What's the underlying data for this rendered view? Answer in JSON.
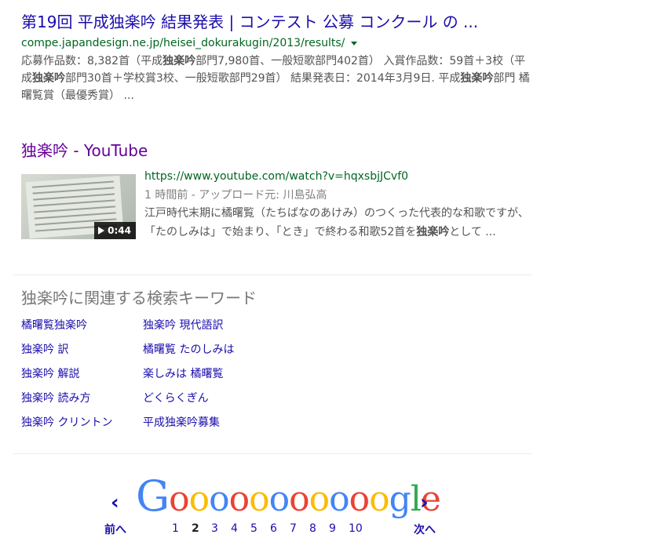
{
  "result1": {
    "title": "第19回 平成独楽吟 結果発表 | コンテスト 公募 コンクール の ...",
    "url": "compe.japandesign.ne.jp/heisei_dokurakugin/2013/results/",
    "snippet": [
      {
        "text": "応募作品数：8,382首（平成",
        "bold": false
      },
      {
        "text": "独楽吟",
        "bold": true
      },
      {
        "text": "部門7,980首、一般短歌部門402首） 入賞作品数：59首＋3校（平成",
        "bold": false
      },
      {
        "text": "独楽吟",
        "bold": true
      },
      {
        "text": "部門30首＋学校賞3校、一般短歌部門29首） 結果発表日：2014年3月9日. 平成",
        "bold": false
      },
      {
        "text": "独楽吟",
        "bold": true
      },
      {
        "text": "部門 橘曙覧賞（最優秀賞） ...",
        "bold": false
      }
    ]
  },
  "result2": {
    "title": "独楽吟 - YouTube",
    "url": "https://www.youtube.com/watch?v=hqxsbjJCvf0",
    "meta": "1 時間前 - アップロード元: 川島弘高",
    "duration": "0:44",
    "snippet": [
      {
        "text": "江戸時代末期に橘曙覧（たちばなのあけみ）のつくった代表的な和歌ですが、「たのしみは」で始まり、「とき」で終わる和歌52首を",
        "bold": false
      },
      {
        "text": "独楽吟",
        "bold": true
      },
      {
        "text": "として ...",
        "bold": false
      }
    ]
  },
  "related": {
    "title": "独楽吟に関連する検索キーワード",
    "items": [
      "橘曙覧独楽吟",
      "独楽吟 現代語訳",
      "独楽吟 訳",
      "橘曙覧 たのしみは",
      "独楽吟 解説",
      "楽しみは 橘曙覧",
      "独楽吟 読み方",
      "どくらくぎん",
      "独楽吟 クリントン",
      "平成独楽吟募集"
    ]
  },
  "pagination": {
    "prev_label": "前へ",
    "next_label": "次へ",
    "logo_text": "Gooooooooooogle",
    "current_page": 2,
    "pages": [
      "1",
      "2",
      "3",
      "4",
      "5",
      "6",
      "7",
      "8",
      "9",
      "10"
    ]
  },
  "icons": {
    "prev": "chevron-left-icon",
    "next": "chevron-right-icon",
    "play": "play-icon",
    "url_menu": "caret-down-icon"
  },
  "colors": {
    "link": "#1a0dab",
    "visited": "#660099",
    "url": "#006621",
    "snippet": "#545454"
  }
}
